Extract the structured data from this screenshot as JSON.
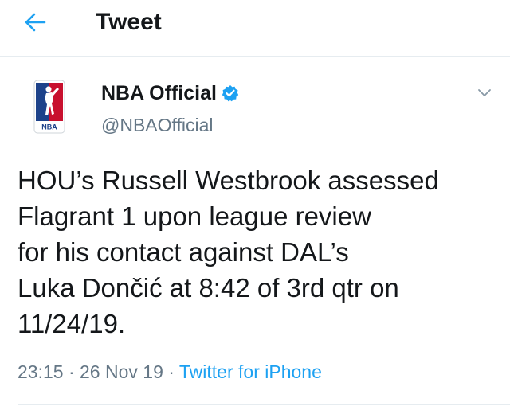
{
  "header": {
    "back_icon": "arrow-left-icon",
    "title": "Tweet"
  },
  "tweet": {
    "author": {
      "name": "NBA Official",
      "handle": "@NBAOfficial",
      "verified": true,
      "avatar_text": "NBA"
    },
    "text_lines": [
      "HOU’s Russell Westbrook assessed",
      "Flagrant 1 upon league review",
      "for his contact against DAL’s",
      "Luka Dončić at 8:42 of 3rd qtr on",
      "11/24/19."
    ],
    "time": "23:15",
    "separator": " · ",
    "date": "26 Nov 19",
    "source": "Twitter for iPhone"
  },
  "colors": {
    "accent": "#1da1f2",
    "secondary_text": "#657786",
    "primary_text": "#14171a",
    "nba_red": "#c8102e",
    "nba_blue": "#1d428a"
  }
}
